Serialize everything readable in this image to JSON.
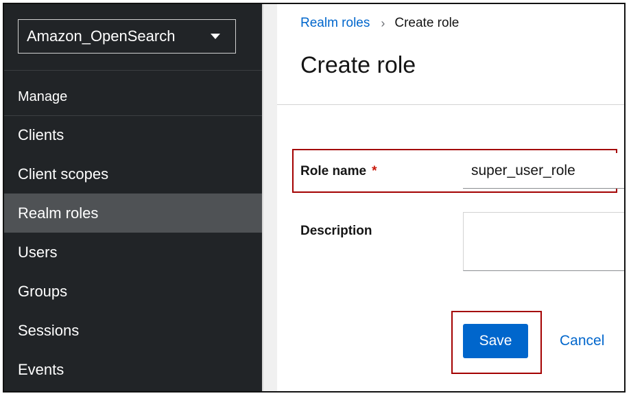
{
  "sidebar": {
    "realm_selector": "Amazon_OpenSearch",
    "section_heading": "Manage",
    "items": [
      {
        "label": "Clients"
      },
      {
        "label": "Client scopes"
      },
      {
        "label": "Realm roles",
        "active": true
      },
      {
        "label": "Users"
      },
      {
        "label": "Groups"
      },
      {
        "label": "Sessions"
      },
      {
        "label": "Events"
      }
    ]
  },
  "breadcrumb": {
    "parent": "Realm roles",
    "current": "Create role"
  },
  "page_title": "Create role",
  "form": {
    "role_name_label": "Role name",
    "required_marker": "*",
    "role_name_value": "super_user_role",
    "description_label": "Description",
    "description_value": ""
  },
  "actions": {
    "save_label": "Save",
    "cancel_label": "Cancel"
  },
  "colors": {
    "sidebar_bg": "#212427",
    "sidebar_active": "#4f5255",
    "link": "#0066cc",
    "primary_button": "#0066cc",
    "highlight_border": "#a30000",
    "required": "#c9190b"
  }
}
